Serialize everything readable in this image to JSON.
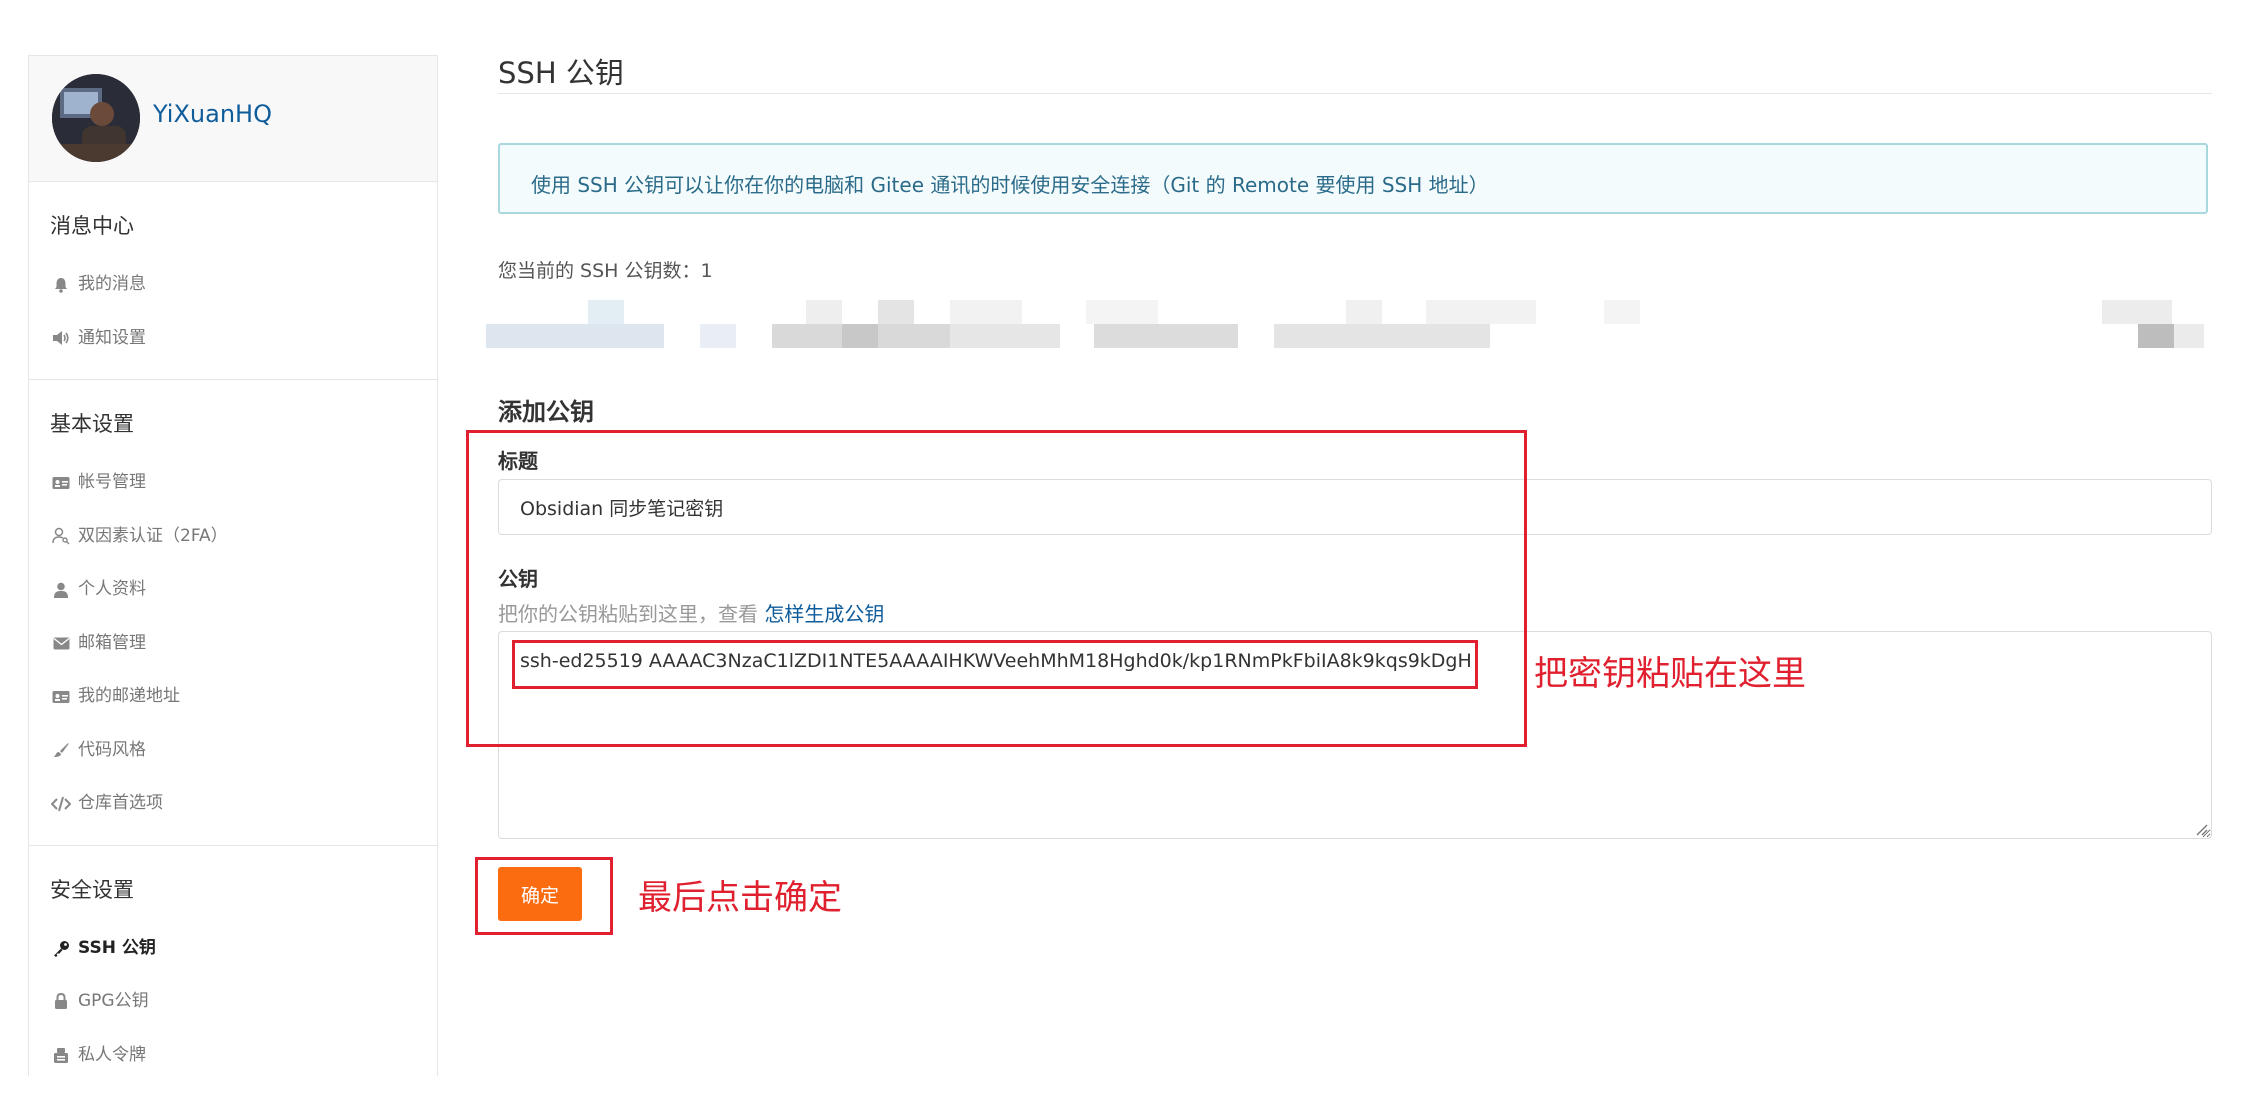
{
  "user": {
    "name": "YiXuanHQ"
  },
  "sidebar": {
    "sections": [
      {
        "title": "消息中心",
        "items": [
          {
            "label": "我的消息",
            "icon": "bell-icon"
          },
          {
            "label": "通知设置",
            "icon": "speaker-icon"
          }
        ]
      },
      {
        "title": "基本设置",
        "items": [
          {
            "label": "帐号管理",
            "icon": "id-card-icon"
          },
          {
            "label": "双因素认证（2FA）",
            "icon": "user-key-icon"
          },
          {
            "label": "个人资料",
            "icon": "user-icon"
          },
          {
            "label": "邮箱管理",
            "icon": "envelope-icon"
          },
          {
            "label": "我的邮递地址",
            "icon": "address-card-icon"
          },
          {
            "label": "代码风格",
            "icon": "brush-icon"
          },
          {
            "label": "仓库首选项",
            "icon": "code-icon"
          }
        ]
      },
      {
        "title": "安全设置",
        "items": [
          {
            "label": "SSH 公钥",
            "icon": "key-icon",
            "active": true
          },
          {
            "label": "GPG公钥",
            "icon": "lock-icon"
          },
          {
            "label": "私人令牌",
            "icon": "token-icon"
          }
        ]
      }
    ]
  },
  "main": {
    "title": "SSH 公钥",
    "info": "使用 SSH 公钥可以让你在你的电脑和 Gitee 通讯的时候使用安全连接（Git 的 Remote 要使用 SSH 地址）",
    "count_label": "您当前的 SSH 公钥数：",
    "count_value": "1",
    "add_title": "添加公钥",
    "title_label": "标题",
    "title_value": "Obsidian 同步笔记密钥",
    "key_label": "公钥",
    "key_hint": "把你的公钥粘贴到这里，查看",
    "key_hint_link": "怎样生成公钥",
    "key_value": "ssh-ed25519 AAAAC3NzaC1lZDI1NTE5AAAAIHKWVeehMhM18Hghd0k/kp1RNmPkFbiIA8k9kqs9kDgH",
    "confirm_label": "确定"
  },
  "annotations": {
    "paste_note": "把密钥粘贴在这里",
    "confirm_note": "最后点击确定"
  },
  "colors": {
    "accent": "#fb6b0f",
    "link": "#0f5c9b",
    "annotation": "#e0202f",
    "info_bg": "#f4fbfc"
  }
}
